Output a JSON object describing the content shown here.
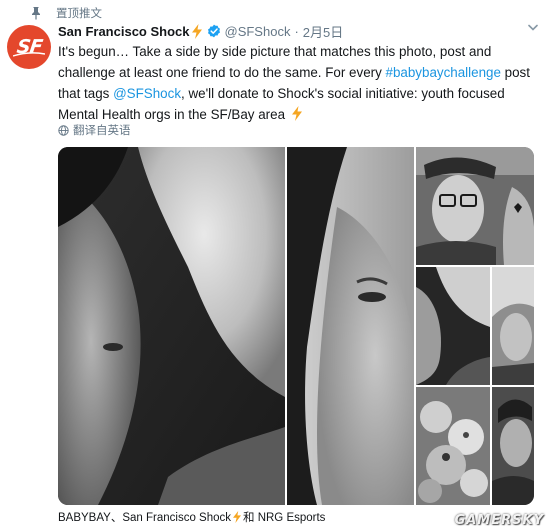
{
  "pinned": {
    "label": "置顶推文"
  },
  "account": {
    "name": "San Francisco Shock",
    "handle": "@SFShock",
    "date": "2月5日",
    "separator": "·",
    "avatar_text": "SF"
  },
  "tweet": {
    "l1": "It's begun…  Take a side by side picture that matches this photo, post and",
    "l2a": "challenge at least one friend to do the same.  For every ",
    "hashtag": "#babybaychallenge",
    "l2b": " post",
    "l3a": "that tags ",
    "mention": "@SFShock",
    "l3b": ", we'll donate to Shock's social initiative: youth focused",
    "l4": "Mental Health orgs in the SF/Bay area "
  },
  "translate": {
    "label": "翻译自英语"
  },
  "tags": {
    "a": "BABYBAY、San Francisco Shock",
    "b": " 和 NRG Esports"
  },
  "watermark": "GAMERSKY",
  "colors": {
    "accent": "#1b95e0",
    "brand": "#e4472c",
    "bolt": "#f5a623",
    "muted": "#657786"
  },
  "icons": [
    "pin-icon",
    "lightning-bolt-icon",
    "verified-badge-icon",
    "chevron-down-icon",
    "globe-icon"
  ]
}
